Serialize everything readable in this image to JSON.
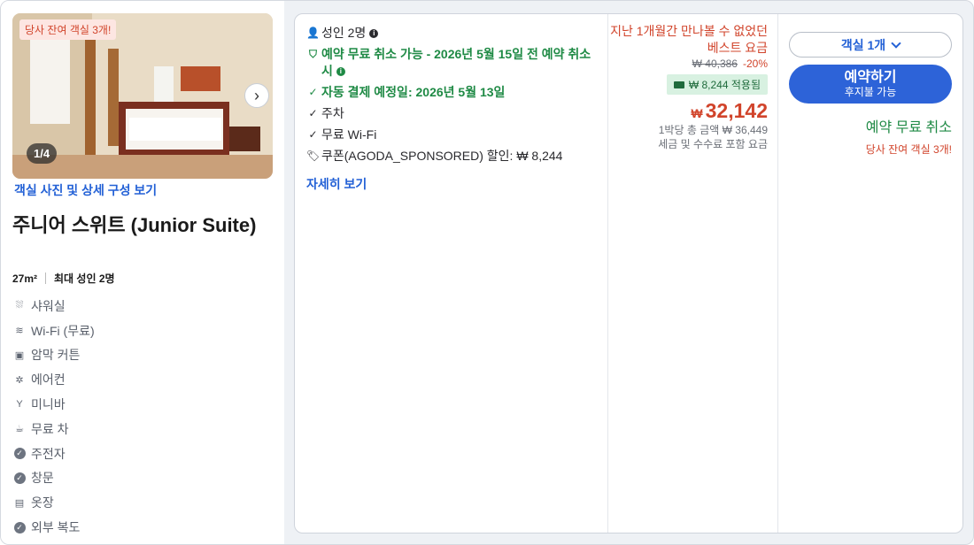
{
  "room": {
    "photo_badge": "당사 잔여 객실 3개!",
    "photo_counter": "1/4",
    "photo_link": "객실 사진 및 상세 구성 보기",
    "name": "주니어 스위트 (Junior Suite)",
    "size": "27m²",
    "max_guests": "최대 성인 2명",
    "amenities": [
      {
        "label": "샤워실",
        "icon": "shower-icon"
      },
      {
        "label": "Wi-Fi (무료)",
        "icon": "wifi-icon"
      },
      {
        "label": "암막 커튼",
        "icon": "curtain-icon"
      },
      {
        "label": "에어컨",
        "icon": "air-conditioner-icon"
      },
      {
        "label": "미니바",
        "icon": "minibar-icon"
      },
      {
        "label": "무료 차",
        "icon": "tea-icon"
      },
      {
        "label": "주전자",
        "icon": "check-circle-icon"
      },
      {
        "label": "창문",
        "icon": "check-circle-icon"
      },
      {
        "label": "옷장",
        "icon": "wardrobe-icon"
      },
      {
        "label": "외부 복도",
        "icon": "check-circle-icon"
      }
    ]
  },
  "offer": {
    "guests": "성인 2명",
    "free_cancel_line": "예약 무료 취소 가능 - 2026년 5월 15일 전 예약 취소 시",
    "auto_payment": "자동 결제 예정일: 2026년 5월 13일",
    "parking": "주차",
    "wifi": "무료 Wi-Fi",
    "coupon": "쿠폰(AGODA_SPONSORED) 할인: ₩ 8,244",
    "more_link": "자세히 보기"
  },
  "price": {
    "best_price_note": "지난 1개월간 만나볼 수 없었던 베스트 요금",
    "original_price": "₩ 40,386",
    "discount_pct": "-20%",
    "coupon_applied": "₩ 8,244 적용됨",
    "currency": "₩",
    "final_price": "32,142",
    "total_line": "1박당 총 금액 ₩ 36,449",
    "tax_line": "세금 및 수수료 포함 요금"
  },
  "actions": {
    "room_select": "객실 1개",
    "book_label": "예약하기",
    "book_sub": "후지불 가능",
    "free_cancel": "예약 무료 취소",
    "rooms_left": "당사 잔여 객실 3개!"
  },
  "colors": {
    "accent_blue": "#2361d6",
    "price_red": "#d1442b",
    "benefit_green": "#1f8a45"
  }
}
